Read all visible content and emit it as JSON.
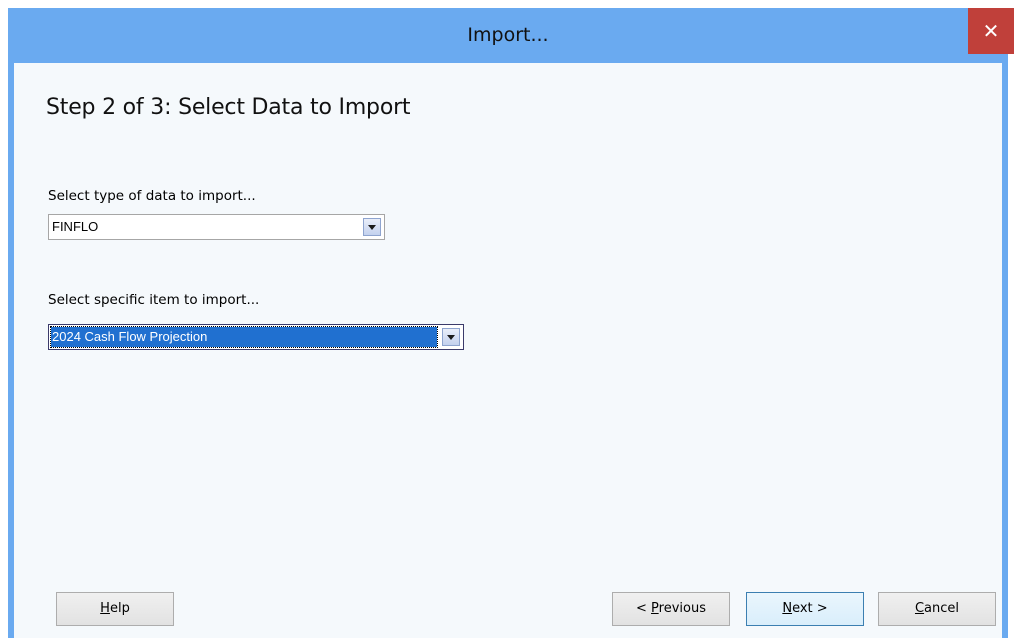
{
  "window": {
    "title": "Import...",
    "close_glyph": "✕"
  },
  "step_title": "Step 2 of 3: Select Data to Import",
  "data_type": {
    "label": "Select type of data to import...",
    "selected": "FINFLO"
  },
  "item": {
    "label": "Select specific item to import...",
    "selected": "2024 Cash Flow Projection"
  },
  "buttons": {
    "help": {
      "mnemonic": "H",
      "rest": "elp"
    },
    "previous": {
      "prefix": "< ",
      "mnemonic": "P",
      "rest": "revious"
    },
    "next": {
      "mnemonic": "N",
      "rest": "ext >"
    },
    "cancel": {
      "mnemonic": "C",
      "rest": "ancel"
    }
  },
  "colors": {
    "titlebar": "#6aaaf0",
    "close": "#c0403a",
    "selection": "#2070d0"
  }
}
